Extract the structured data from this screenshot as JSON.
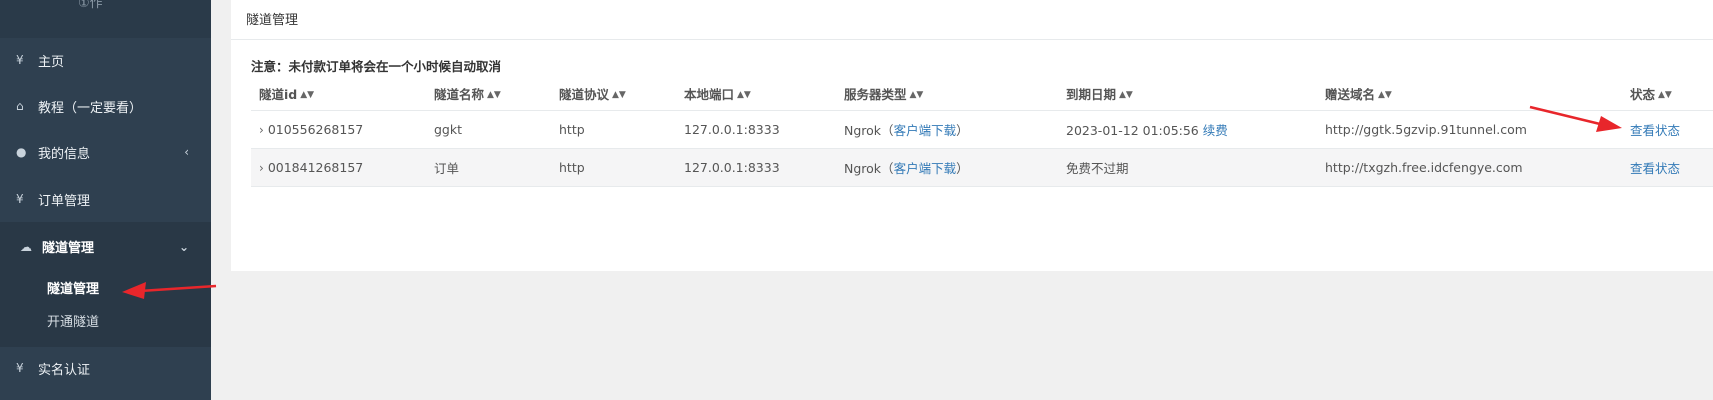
{
  "sidebar": {
    "logo_partial": "①作",
    "items": [
      {
        "icon": "yen-icon",
        "glyph": "¥",
        "label": "主页"
      },
      {
        "icon": "home-icon",
        "glyph": "⌂",
        "label": "教程（一定要看）"
      },
      {
        "icon": "user-icon",
        "glyph": "●",
        "label": "我的信息",
        "arrow": "‹"
      },
      {
        "icon": "yen-icon",
        "glyph": "¥",
        "label": "订单管理"
      },
      {
        "icon": "cloud-icon",
        "glyph": "☁",
        "label": "隧道管理",
        "arrow": "⌄"
      },
      {
        "icon": "yen-icon",
        "glyph": "¥",
        "label": "实名认证"
      }
    ],
    "submenu": [
      "隧道管理",
      "开通隧道"
    ]
  },
  "panel": {
    "title": "隧道管理",
    "notice": "注意：未付款订单将会在一个小时候自动取消"
  },
  "table": {
    "headers": [
      "隧道id",
      "隧道名称",
      "隧道协议",
      "本地端口",
      "服务器类型",
      "到期日期",
      "赠送域名",
      "状态"
    ],
    "rows": [
      {
        "id": "010556268157",
        "name": "ggkt",
        "protocol": "http",
        "port": "127.0.0.1:8333",
        "server": "Ngrok",
        "download": "客户端下载",
        "expire": "2023-01-12 01:05:56",
        "renew": "续费",
        "domain": "http://ggtk.5gzvip.91tunnel.com",
        "status": "查看状态"
      },
      {
        "id": "001841268157",
        "name": "订单",
        "protocol": "http",
        "port": "127.0.0.1:8333",
        "server": "Ngrok",
        "download": "客户端下载",
        "expire": "免费不过期",
        "renew": "",
        "domain": "http://txgzh.free.idcfengye.com",
        "status": "查看状态"
      }
    ]
  },
  "colors": {
    "sidebar": "#2f4050",
    "link": "#337ab7",
    "arrow": "#e8262b"
  }
}
